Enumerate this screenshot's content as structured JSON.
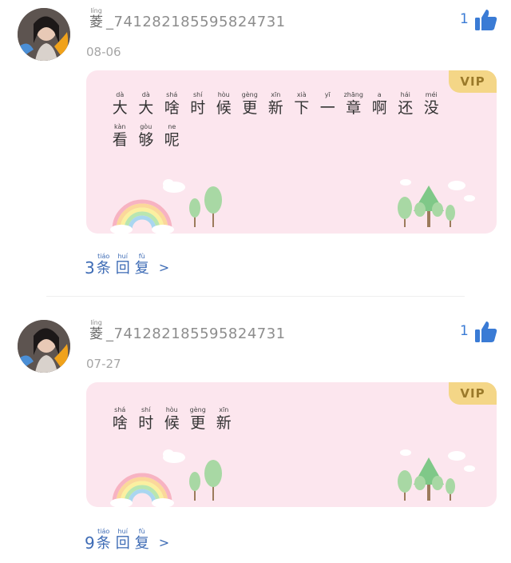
{
  "comments": [
    {
      "username_prefix": {
        "char": "菱",
        "pinyin": "líng"
      },
      "username_rest": "_741282185595824731",
      "date": "08-06",
      "likes": "1",
      "vip": "VIP",
      "content": [
        {
          "hz": "大",
          "py": "dà"
        },
        {
          "hz": "大",
          "py": "dà"
        },
        {
          "hz": "啥",
          "py": "shá"
        },
        {
          "hz": "时",
          "py": "shí"
        },
        {
          "hz": "候",
          "py": "hòu"
        },
        {
          "hz": "更",
          "py": "gèng"
        },
        {
          "hz": "新",
          "py": "xīn"
        },
        {
          "hz": "下",
          "py": "xià"
        },
        {
          "hz": "一",
          "py": "yī"
        },
        {
          "hz": "章",
          "py": "zhāng"
        },
        {
          "hz": "啊",
          "py": "a"
        },
        {
          "hz": "还",
          "py": "hái"
        },
        {
          "hz": "没",
          "py": "méi"
        },
        {
          "hz": "看",
          "py": "kàn"
        },
        {
          "hz": "够",
          "py": "gòu"
        },
        {
          "hz": "呢",
          "py": "ne"
        }
      ],
      "reply_count": "3",
      "reply_label": [
        {
          "hz": "条",
          "py": "tiáo"
        },
        {
          "hz": "回",
          "py": "huí"
        },
        {
          "hz": "复",
          "py": "fù"
        }
      ],
      "reply_arrow": ">"
    },
    {
      "username_prefix": {
        "char": "菱",
        "pinyin": "líng"
      },
      "username_rest": "_741282185595824731",
      "date": "07-27",
      "likes": "1",
      "vip": "VIP",
      "content": [
        {
          "hz": "啥",
          "py": "shá"
        },
        {
          "hz": "时",
          "py": "shí"
        },
        {
          "hz": "候",
          "py": "hòu"
        },
        {
          "hz": "更",
          "py": "gèng"
        },
        {
          "hz": "新",
          "py": "xīn"
        }
      ],
      "reply_count": "9",
      "reply_label": [
        {
          "hz": "条",
          "py": "tiáo"
        },
        {
          "hz": "回",
          "py": "huí"
        },
        {
          "hz": "复",
          "py": "fù"
        }
      ],
      "reply_arrow": ">"
    }
  ],
  "icons": {
    "like": "thumbs-up-icon"
  },
  "colors": {
    "card_bg": "#fce6ee",
    "vip_bg": "#f4d687",
    "like_blue": "#3a7bd5",
    "reply_blue": "#3d6bb5"
  }
}
